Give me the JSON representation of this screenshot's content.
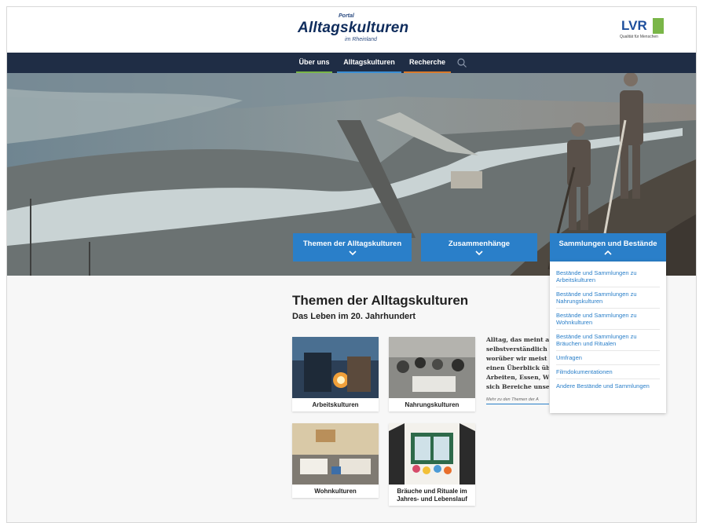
{
  "header": {
    "logo_small": "Portal",
    "logo_main": "Alltagskulturen",
    "logo_sub": "im Rheinland",
    "lvr_text": "LVR",
    "lvr_tagline": "Qualität für Menschen"
  },
  "nav": {
    "items": [
      "Über uns",
      "Alltagskulturen",
      "Recherche"
    ]
  },
  "dropdowns": {
    "themen": "Themen der Alltagskulturen",
    "zusammen": "Zusammenhänge",
    "sammlungen": "Sammlungen und Bestände"
  },
  "menu": {
    "items": [
      "Bestände und Sammlungen zu Arbeitskulturen",
      "Bestände und Sammlungen zu Nahrungskulturen",
      "Bestände und Sammlungen zu Wohnkulturen",
      "Bestände und Sammlungen zu Bräuchen und Ritualen",
      "Umfragen",
      "Filmdokumentationen",
      "Andere Bestände und Sammlungen"
    ]
  },
  "main": {
    "title": "Themen der Alltagskulturen",
    "subtitle": "Das Leben im 20. Jahrhundert",
    "cards": [
      "Arbeitskulturen",
      "Nahrungskulturen",
      "Wohnkulturen",
      "Bräuche und Rituale im Jahres- und Lebenslauf"
    ],
    "intro_lines": [
      "Alltag, das meint all",
      "selbstverständlich is",
      "worüber wir meist ka",
      "einen Überblick über",
      "Arbeiten, Essen, Wol",
      "sich Bereiche unsere"
    ],
    "more_link": "Mehr zu den Themen der A"
  },
  "colors": {
    "nav_bg": "#1f2d45",
    "accent_blue": "#2a7fc9",
    "accent_green": "#7ab648",
    "accent_orange": "#d97a2b"
  }
}
